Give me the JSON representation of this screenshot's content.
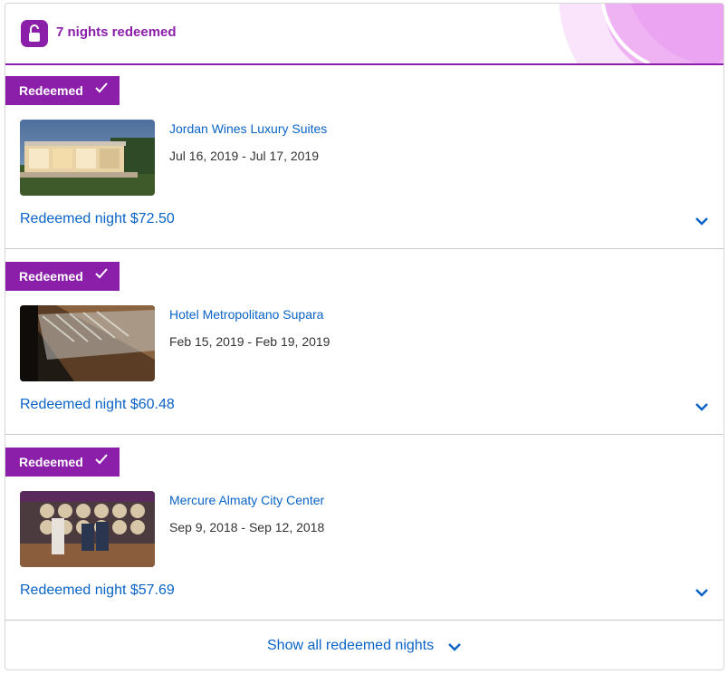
{
  "header": {
    "title": "7 nights redeemed",
    "icon": "lock-open-icon",
    "accent_color": "#8b1fa9"
  },
  "nights": [
    {
      "tag": "Redeemed",
      "hotel": "Jordan Wines Luxury Suites",
      "dates": "Jul 16, 2019 - Jul 17, 2019",
      "redeemed_value": "Redeemed night $72.50"
    },
    {
      "tag": "Redeemed",
      "hotel": "Hotel Metropolitano Supara",
      "dates": "Feb 15, 2019 - Feb 19, 2019",
      "redeemed_value": "Redeemed night $60.48"
    },
    {
      "tag": "Redeemed",
      "hotel": "Mercure Almaty City Center",
      "dates": "Sep 9, 2018 - Sep 12, 2018",
      "redeemed_value": "Redeemed night $57.69"
    }
  ],
  "footer": {
    "show_all_label": "Show all redeemed nights"
  },
  "colors": {
    "link": "#0a63c7",
    "tag_bg": "#8b1fa9"
  }
}
